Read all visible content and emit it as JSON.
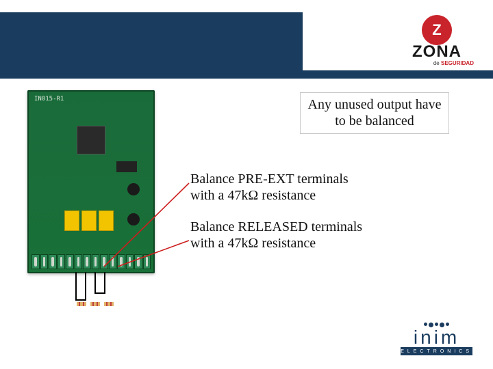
{
  "header": {
    "title": ""
  },
  "top_logo": {
    "brand": "ZONA",
    "tag_de": "de ",
    "tag_seg": "SEGURIDAD",
    "mark": "Z"
  },
  "pcb": {
    "silk_label": "IN015-R1"
  },
  "note": {
    "text": "Any unused output have to be balanced"
  },
  "callouts": {
    "pre_ext": {
      "line1": "Balance PRE-EXT terminals",
      "line2": " with a 47kΩ resistance"
    },
    "released": {
      "line1": "Balance RELEASED terminals",
      "line2": " with a 47kΩ resistance"
    }
  },
  "bottom_logo": {
    "name": "inim",
    "subtitle": "ELECTRONICS"
  },
  "colors": {
    "brand_blue": "#1a3c5e",
    "brand_red": "#c9232b",
    "pcb_green": "#197038",
    "relay_yellow": "#f2c400"
  }
}
